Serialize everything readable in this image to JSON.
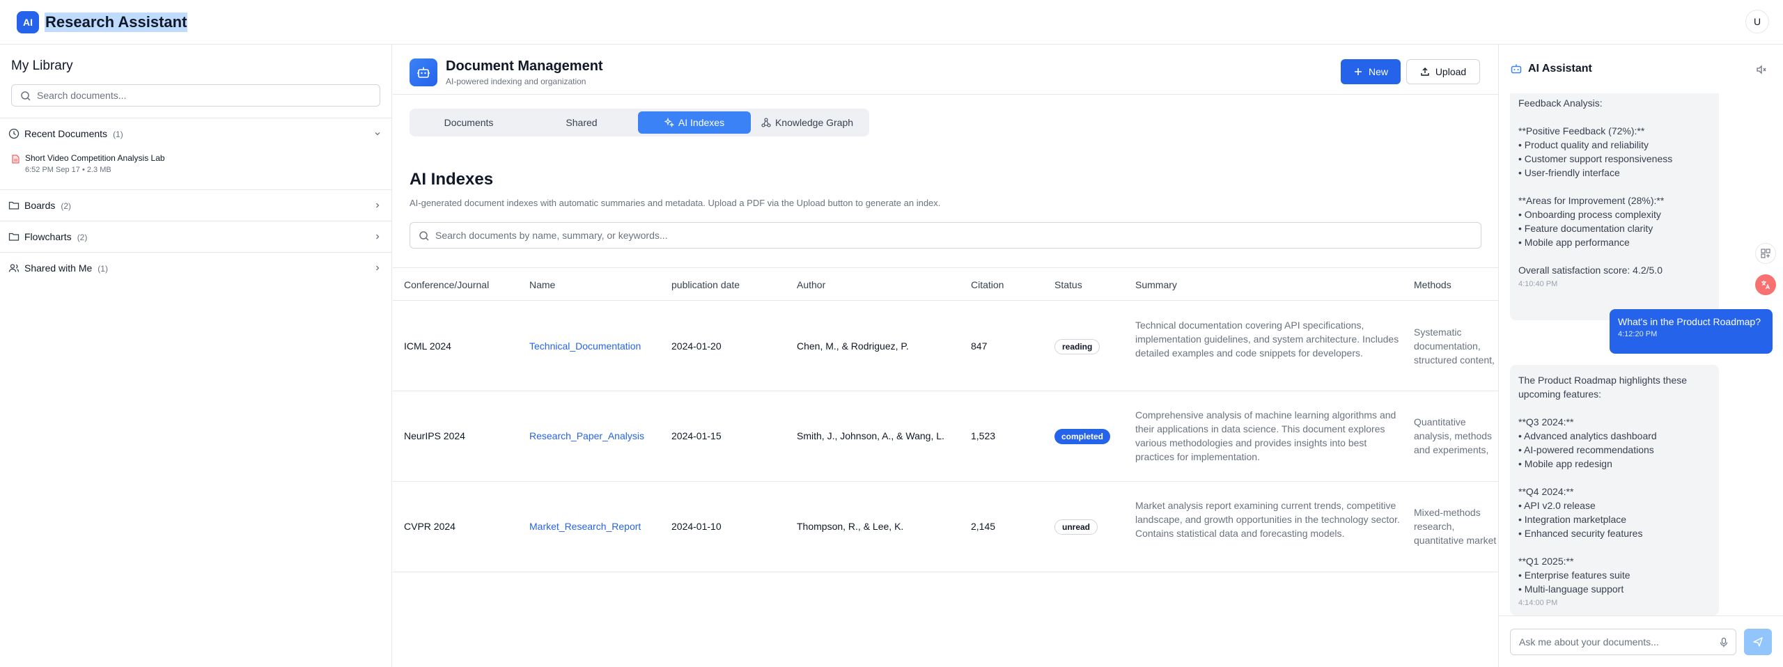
{
  "app": {
    "logo_text": "AI",
    "title": "Research Assistant",
    "avatar": "U"
  },
  "sidebar": {
    "title": "My Library",
    "search_placeholder": "Search documents...",
    "recent": {
      "label": "Recent Documents",
      "count": "(1)"
    },
    "recent_doc": {
      "name": "Short Video Competition Analysis Lab",
      "meta": "6:52 PM Sep 17 • 2.3 MB"
    },
    "sections": [
      {
        "label": "Boards",
        "count": "(2)"
      },
      {
        "label": "Flowcharts",
        "count": "(2)"
      },
      {
        "label": "Shared with Me",
        "count": "(1)"
      }
    ]
  },
  "main": {
    "header_title": "Document Management",
    "header_subtitle": "AI-powered indexing and organization",
    "new_label": "New",
    "upload_label": "Upload",
    "tabs": [
      {
        "label": "Documents"
      },
      {
        "label": "Shared"
      },
      {
        "label": "AI Indexes"
      },
      {
        "label": "Knowledge Graph"
      }
    ],
    "section_title": "AI Indexes",
    "section_desc": "AI-generated document indexes with automatic summaries and metadata. Upload a PDF via the Upload button to generate an index.",
    "search_placeholder": "Search documents by name, summary, or keywords...",
    "columns": [
      "Conference/Journal",
      "Name",
      "publication date",
      "Author",
      "Citation",
      "Status",
      "Summary",
      "Methods"
    ],
    "rows": [
      {
        "venue": "ICML 2024",
        "name": "Technical_Documentation",
        "date": "2024-01-20",
        "author": "Chen, M., & Rodriguez, P.",
        "citation": "847",
        "status": "reading",
        "summary": "Technical documentation covering API specifications, implementation guidelines, and system architecture. Includes detailed examples and code snippets for developers.",
        "methods": "Systematic documentation, structured content, practical examples"
      },
      {
        "venue": "NeurIPS 2024",
        "name": "Research_Paper_Analysis",
        "date": "2024-01-15",
        "author": "Smith, J., Johnson, A., & Wang, L.",
        "citation": "1,523",
        "status": "completed",
        "summary": "Comprehensive analysis of machine learning algorithms and their applications in data science. This document explores various methodologies and provides insights into best practices for implementation.",
        "methods": "Quantitative analysis, methods and experiments, cross-validation techniques"
      },
      {
        "venue": "CVPR 2024",
        "name": "Market_Research_Report",
        "date": "2024-01-10",
        "author": "Thompson, R., & Lee, K.",
        "citation": "2,145",
        "status": "unread",
        "summary": "Market analysis report examining current trends, competitive landscape, and growth opportunities in the technology sector. Contains statistical data and forecasting models.",
        "methods": "Mixed-methods research, quantitative market data, qualitative stakeholder"
      }
    ]
  },
  "assistant": {
    "title": "AI Assistant",
    "messages": [
      {
        "role": "ai",
        "text": "Feedback Analysis:\n\n**Positive Feedback (72%):**\n• Product quality and reliability\n• Customer support responsiveness\n• User-friendly interface\n\n**Areas for Improvement (28%):**\n• Onboarding process complexity\n• Feature documentation clarity\n• Mobile app performance\n\nOverall satisfaction score: 4.2/5.0",
        "time": "4:10:40 PM"
      },
      {
        "role": "user",
        "text": "What's in the Product Roadmap?",
        "time": "4:12:20 PM"
      },
      {
        "role": "ai",
        "text": "The Product Roadmap highlights these upcoming features:\n\n**Q3 2024:**\n• Advanced analytics dashboard\n• AI-powered recommendations\n• Mobile app redesign\n\n**Q4 2024:**\n• API v2.0 release\n• Integration marketplace\n• Enhanced security features\n\n**Q1 2025:**\n• Enterprise features suite\n• Multi-language support",
        "time": "4:14:00 PM"
      }
    ],
    "input_placeholder": "Ask me about your documents..."
  },
  "colors": {
    "accent": "#2563eb",
    "tab_active": "#3b82f6",
    "send_disabled": "#93c5fd"
  }
}
